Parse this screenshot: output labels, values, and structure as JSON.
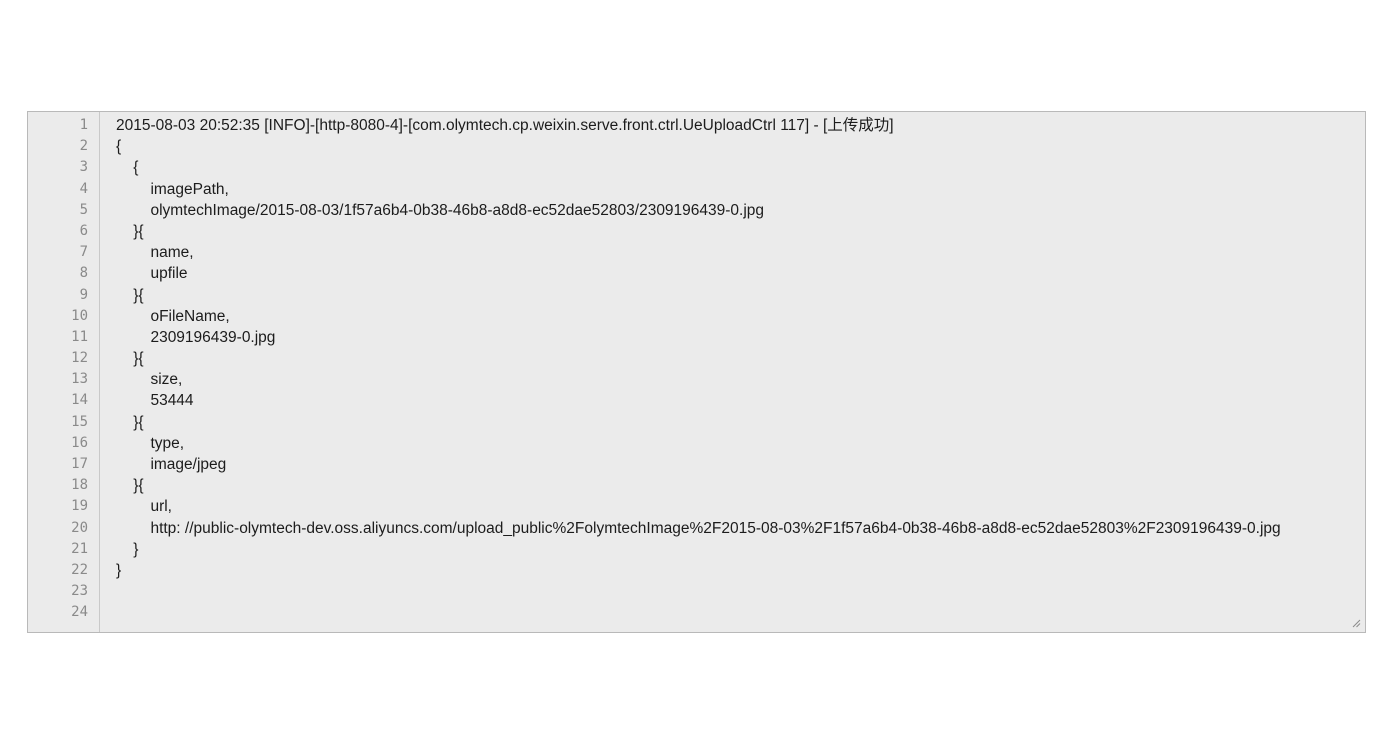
{
  "editor": {
    "line_numbers": [
      "1",
      "2",
      "3",
      "4",
      "5",
      "6",
      "7",
      "8",
      "9",
      "10",
      "11",
      "12",
      "13",
      "14",
      "15",
      "16",
      "17",
      "18",
      "19",
      "20",
      "21",
      "22",
      "23",
      "24"
    ],
    "lines": [
      "2015-08-03 20:52:35 [INFO]-[http-8080-4]-[com.olymtech.cp.weixin.serve.front.ctrl.UeUploadCtrl 117] - [上传成功]",
      "{",
      "    {",
      "        imagePath,",
      "        olymtechImage/2015-08-03/1f57a6b4-0b38-46b8-a8d8-ec52dae52803/2309196439-0.jpg",
      "    }{",
      "        name,",
      "        upfile",
      "    }{",
      "        oFileName,",
      "        2309196439-0.jpg",
      "    }{",
      "        size,",
      "        53444",
      "    }{",
      "        type,",
      "        image/jpeg",
      "    }{",
      "        url,",
      "        http: //public-olymtech-dev.oss.aliyuncs.com/upload_public%2FolymtechImage%2F2015-08-03%2F1f57a6b4-0b38-46b8-a8d8-ec52dae52803%2F2309196439-0.jpg",
      "    }",
      "}",
      "",
      ""
    ]
  }
}
